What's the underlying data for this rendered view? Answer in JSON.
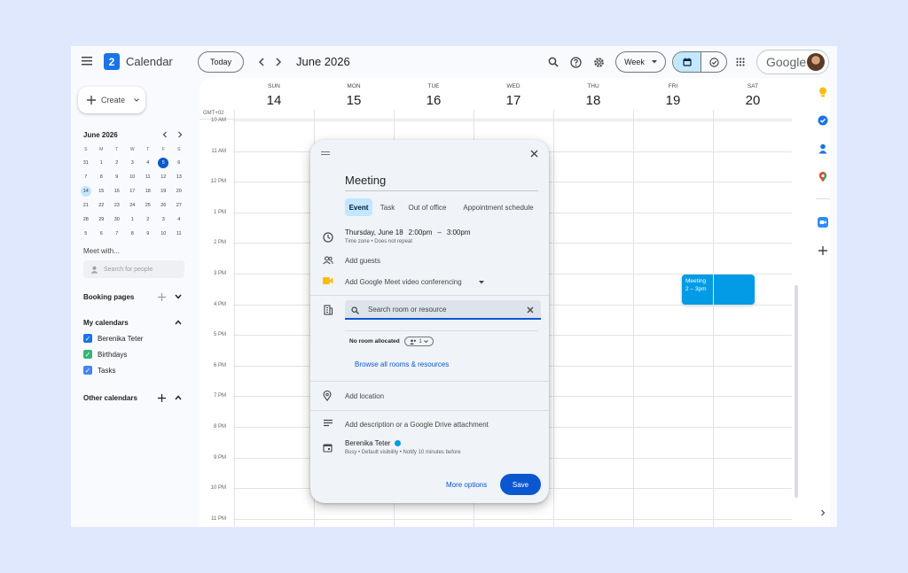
{
  "header": {
    "app_name": "Calendar",
    "logo_number": "2",
    "today_label": "Today",
    "month_title": "June 2026",
    "view_label": "Week",
    "google_label": "Google"
  },
  "sidebar": {
    "create_label": "Create",
    "mini_calendar": {
      "title": "June 2026",
      "weekday_headers": [
        "S",
        "M",
        "T",
        "W",
        "T",
        "F",
        "S"
      ],
      "weeks": [
        [
          "31",
          "1",
          "2",
          "3",
          "4",
          "5",
          "6"
        ],
        [
          "7",
          "8",
          "9",
          "10",
          "11",
          "12",
          "13"
        ],
        [
          "14",
          "15",
          "16",
          "17",
          "18",
          "19",
          "20"
        ],
        [
          "21",
          "22",
          "23",
          "24",
          "25",
          "26",
          "27"
        ],
        [
          "28",
          "29",
          "30",
          "1",
          "2",
          "3",
          "4"
        ],
        [
          "5",
          "6",
          "7",
          "8",
          "9",
          "10",
          "11"
        ]
      ],
      "today": "5",
      "selected": "14"
    },
    "meet_with_label": "Meet with...",
    "search_people_placeholder": "Search for people",
    "booking_pages_label": "Booking pages",
    "my_calendars_label": "My calendars",
    "my_calendars": [
      {
        "name": "Berenika Teter",
        "color": "#1a73e8"
      },
      {
        "name": "Birthdays",
        "color": "#33b679"
      },
      {
        "name": "Tasks",
        "color": "#4285f4"
      }
    ],
    "other_calendars_label": "Other calendars"
  },
  "calendar": {
    "timezone": "GMT+02",
    "days": [
      {
        "name": "SUN",
        "num": "14"
      },
      {
        "name": "MON",
        "num": "15"
      },
      {
        "name": "TUE",
        "num": "16"
      },
      {
        "name": "WED",
        "num": "17"
      },
      {
        "name": "THU",
        "num": "18"
      },
      {
        "name": "FRI",
        "num": "19"
      },
      {
        "name": "SAT",
        "num": "20"
      }
    ],
    "hours": [
      "10 AM",
      "11 AM",
      "12 PM",
      "1 PM",
      "2 PM",
      "3 PM",
      "4 PM",
      "5 PM",
      "6 PM",
      "7 PM",
      "8 PM",
      "9 PM",
      "10 PM",
      "11 PM"
    ],
    "event": {
      "title": "Meeting",
      "time": "2 – 3pm",
      "color": "#039be5"
    }
  },
  "dialog": {
    "title": "Meeting",
    "tabs": [
      "Event",
      "Task",
      "Out of office",
      "Appointment schedule"
    ],
    "date": "Thursday, June 18",
    "start_time": "2:00pm",
    "dash": "–",
    "end_time": "3:00pm",
    "timezone_note": "Time zone • Does not repeat",
    "add_guests": "Add guests",
    "meet_label": "Add Google Meet video conferencing",
    "room_search_placeholder": "Search room or resource",
    "no_room": "No room allocated",
    "chip_count": "1",
    "browse_rooms": "Browse all rooms & resources",
    "add_location": "Add location",
    "add_description": "Add description or a Google Drive attachment",
    "owner_name": "Berenika Teter",
    "owner_details": "Busy • Default visibility • Notify 10 minutes before",
    "more_options": "More options",
    "save_label": "Save"
  }
}
